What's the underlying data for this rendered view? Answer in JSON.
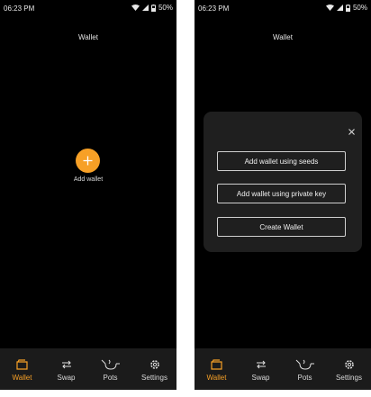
{
  "status": {
    "time": "06:23 PM",
    "battery": "50%"
  },
  "appbar": {
    "title": "Wallet"
  },
  "empty_state": {
    "add_label": "Add wallet"
  },
  "nav": {
    "items": [
      {
        "label": "Wallet",
        "icon": "wallet-icon",
        "active": true
      },
      {
        "label": "Swap",
        "icon": "swap-icon",
        "active": false
      },
      {
        "label": "Pots",
        "icon": "pots-icon",
        "active": false
      },
      {
        "label": "Settings",
        "icon": "settings-gear-icon",
        "active": false
      }
    ]
  },
  "dialog": {
    "options": [
      {
        "label": "Add wallet using seeds"
      },
      {
        "label": "Add wallet using private key"
      },
      {
        "label": "Create Wallet"
      }
    ]
  },
  "colors": {
    "accent": "#f7a026",
    "background": "#000000",
    "nav_background": "#1b1b1b",
    "dialog_background": "#1f1f1f"
  }
}
